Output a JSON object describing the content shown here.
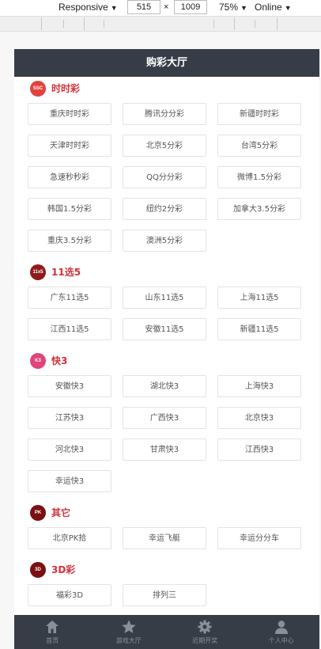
{
  "devtools": {
    "mode": "Responsive",
    "width": "515",
    "times": "×",
    "height": "1009",
    "zoom": "75%",
    "network": "Online"
  },
  "header": {
    "title": "购彩大厅"
  },
  "sections": [
    {
      "id": "ssc",
      "title": "时时彩",
      "logo_text": "SSC",
      "color": "#e0433f",
      "games": [
        "重庆时时彩",
        "腾讯分分彩",
        "新疆时时彩",
        "天津时时彩",
        "北京5分彩",
        "台湾5分彩",
        "急速秒秒彩",
        "QQ分分彩",
        "微博1.5分彩",
        "韩国1.5分彩",
        "纽约2分彩",
        "加拿大3.5分彩",
        "重庆3.5分彩",
        "澳洲5分彩"
      ]
    },
    {
      "id": "11x5",
      "title": "11选5",
      "logo_text": "11x5",
      "color": "#8f1b1b",
      "games": [
        "广东11选5",
        "山东11选5",
        "上海11选5",
        "江西11选5",
        "安徽11选5",
        "新疆11选5"
      ]
    },
    {
      "id": "k3",
      "title": "快3",
      "logo_text": "K3",
      "color": "#e0457a",
      "games": [
        "安徽快3",
        "湖北快3",
        "上海快3",
        "江苏快3",
        "广西快3",
        "北京快3",
        "河北快3",
        "甘肃快3",
        "江西快3",
        "幸运快3"
      ]
    },
    {
      "id": "other",
      "title": "其它",
      "logo_text": "PK",
      "color": "#7a1010",
      "games": [
        "北京PK拾",
        "幸运飞艇",
        "幸运分分车"
      ]
    },
    {
      "id": "3d",
      "title": "3D彩",
      "logo_text": "3D",
      "color": "#7a1010",
      "games": [
        "福彩3D",
        "排列三"
      ]
    }
  ],
  "tabbar": [
    {
      "label": "首页",
      "icon": "home-icon"
    },
    {
      "label": "游戏大厅",
      "icon": "star-icon"
    },
    {
      "label": "近期开奖",
      "icon": "gear-icon"
    },
    {
      "label": "个人中心",
      "icon": "user-icon"
    }
  ]
}
